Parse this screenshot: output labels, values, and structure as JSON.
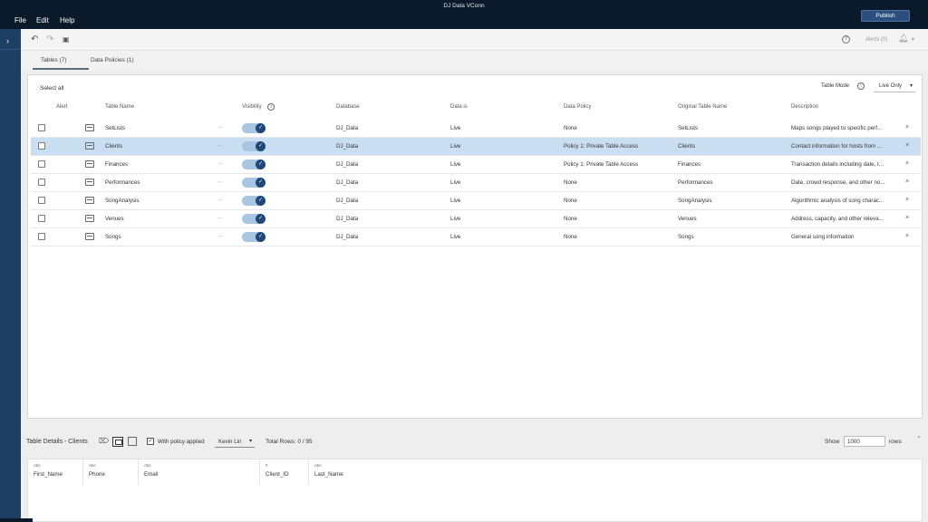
{
  "app": {
    "window_title": "DJ Data VConn",
    "menu": [
      "File",
      "Edit",
      "Help"
    ],
    "publish_label": "Publish"
  },
  "toolbar": {
    "undo_icon": "undo-icon",
    "redo_icon": "redo-icon",
    "save_icon": "save-icon",
    "help_icon_glyph": "?",
    "alerts_label": "Alerts (0)"
  },
  "tabs": [
    {
      "label": "Tables (7)",
      "active": true
    },
    {
      "label": "Data Policies (1)",
      "active": false
    }
  ],
  "panel": {
    "select_all": "Select all",
    "table_mode_label": "Table Mode",
    "table_mode_value": "Live Only",
    "headers": {
      "alert": "Alert",
      "table_name": "Table Name",
      "visibility": "Visibility",
      "database": "Database",
      "data_is": "Data is",
      "data_policy": "Data Policy",
      "original_table_name": "Original Table Name",
      "description": "Description"
    },
    "rows": [
      {
        "name": "SetLists",
        "more": "...",
        "database": "DJ_Data",
        "data_is": "Live",
        "policy": "None",
        "original": "SetLists",
        "description": "Maps songs played to specific perf...",
        "selected": false
      },
      {
        "name": "Clients",
        "more": "...",
        "database": "DJ_Data",
        "data_is": "Live",
        "policy": "Policy 1: Private Table Access",
        "original": "Clients",
        "description": "Contact information for hosts from ...",
        "selected": true
      },
      {
        "name": "Finances",
        "more": "...",
        "database": "DJ_Data",
        "data_is": "Live",
        "policy": "Policy 1: Private Table Access",
        "original": "Finances",
        "description": "Transaction details including date, t...",
        "selected": false
      },
      {
        "name": "Performances",
        "more": "...",
        "database": "DJ_Data",
        "data_is": "Live",
        "policy": "None",
        "original": "Performances",
        "description": "Date, crowd response, and other no...",
        "selected": false
      },
      {
        "name": "SongAnalysis",
        "more": "...",
        "database": "DJ_Data",
        "data_is": "Live",
        "policy": "None",
        "original": "SongAnalysis",
        "description": "Algorithmic analysis of song charac...",
        "selected": false
      },
      {
        "name": "Venues",
        "more": "...",
        "database": "DJ_Data",
        "data_is": "Live",
        "policy": "None",
        "original": "Venues",
        "description": "Address, capacity, and other releva...",
        "selected": false
      },
      {
        "name": "Songs",
        "more": "...",
        "database": "DJ_Data",
        "data_is": "Live",
        "policy": "None",
        "original": "Songs",
        "description": "General song information",
        "selected": false
      }
    ]
  },
  "details": {
    "title": "Table Details - Clients",
    "with_policy_label": "With policy applied",
    "user": "Kevin Lin",
    "total_rows": "Total Rows: 0 / 95",
    "show_label": "Show",
    "show_value": "1000",
    "rows_label": "rows",
    "columns": [
      {
        "type": "Abc",
        "name": "First_Name"
      },
      {
        "type": "Abc",
        "name": "Phone"
      },
      {
        "type": "Abc",
        "name": "Email"
      },
      {
        "type": "#",
        "name": "Client_ID"
      },
      {
        "type": "Abc",
        "name": "Last_Name"
      }
    ]
  }
}
